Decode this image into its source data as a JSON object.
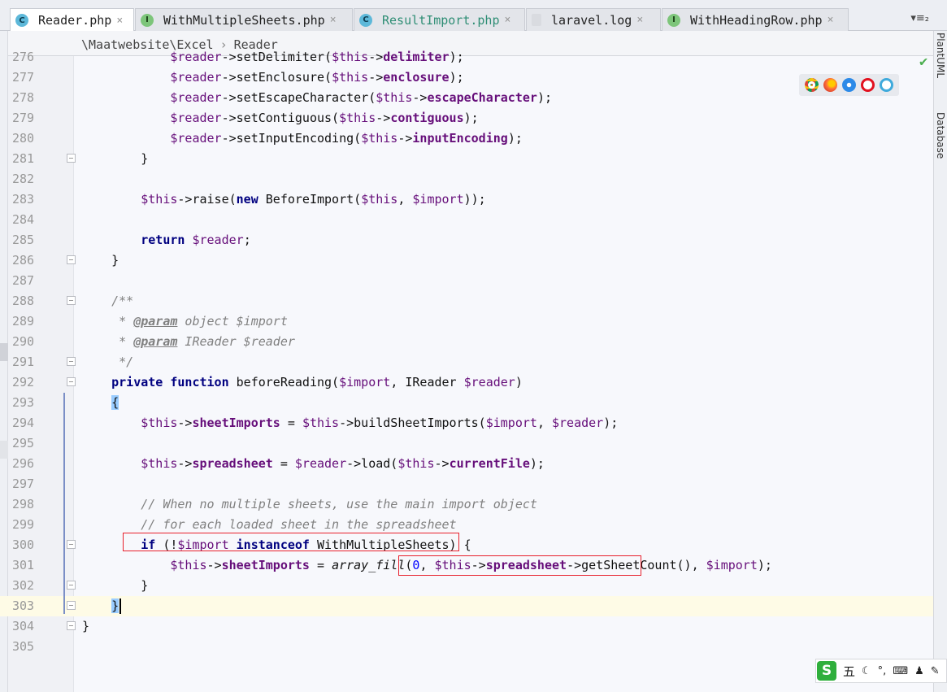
{
  "tabs": [
    {
      "label": "Reader.php",
      "icon": "C",
      "kind": "class",
      "active": true
    },
    {
      "label": "WithMultipleSheets.php",
      "icon": "I",
      "kind": "interface",
      "active": false
    },
    {
      "label": "ResultImport.php",
      "icon": "C",
      "kind": "class",
      "active": false
    },
    {
      "label": "laravel.log",
      "icon": "",
      "kind": "file",
      "active": false
    },
    {
      "label": "WithHeadingRow.php",
      "icon": "I",
      "kind": "interface",
      "active": false
    }
  ],
  "tab_close_glyph": "×",
  "tab_overflow_label": "▾≡₂",
  "breadcrumb": {
    "namespace": "\\Maatwebsite\\Excel",
    "separator": "›",
    "class": "Reader"
  },
  "right_tool_windows": [
    "PlantUML",
    "Database"
  ],
  "ime": {
    "logo": "S",
    "mode": "五",
    "items": [
      "☾",
      "°,",
      "⌨",
      "♟",
      "✎"
    ]
  },
  "lines": [
    {
      "n": "276",
      "tokens": [
        [
          "v",
          "            $reader"
        ],
        [
          "t",
          "->setDelimiter("
        ],
        [
          "v",
          "$this"
        ],
        [
          "t",
          "->"
        ],
        [
          "p",
          "delimiter"
        ],
        [
          "t",
          ");"
        ]
      ]
    },
    {
      "n": "277",
      "tokens": [
        [
          "v",
          "            $reader"
        ],
        [
          "t",
          "->setEnclosure("
        ],
        [
          "v",
          "$this"
        ],
        [
          "t",
          "->"
        ],
        [
          "p",
          "enclosure"
        ],
        [
          "t",
          ");"
        ]
      ]
    },
    {
      "n": "278",
      "tokens": [
        [
          "v",
          "            $reader"
        ],
        [
          "t",
          "->setEscapeCharacter("
        ],
        [
          "v",
          "$this"
        ],
        [
          "t",
          "->"
        ],
        [
          "p",
          "escapeCharacter"
        ],
        [
          "t",
          ");"
        ]
      ]
    },
    {
      "n": "279",
      "tokens": [
        [
          "v",
          "            $reader"
        ],
        [
          "t",
          "->setContiguous("
        ],
        [
          "v",
          "$this"
        ],
        [
          "t",
          "->"
        ],
        [
          "p",
          "contiguous"
        ],
        [
          "t",
          ");"
        ]
      ]
    },
    {
      "n": "280",
      "tokens": [
        [
          "v",
          "            $reader"
        ],
        [
          "t",
          "->setInputEncoding("
        ],
        [
          "v",
          "$this"
        ],
        [
          "t",
          "->"
        ],
        [
          "p",
          "inputEncoding"
        ],
        [
          "t",
          ");"
        ]
      ]
    },
    {
      "n": "281",
      "tokens": [
        [
          "t",
          "        }"
        ]
      ]
    },
    {
      "n": "282",
      "tokens": []
    },
    {
      "n": "283",
      "tokens": [
        [
          "v",
          "        $this"
        ],
        [
          "t",
          "->raise("
        ],
        [
          "k",
          "new"
        ],
        [
          "t",
          " BeforeImport("
        ],
        [
          "v",
          "$this"
        ],
        [
          "t",
          ", "
        ],
        [
          "v",
          "$import"
        ],
        [
          "t",
          "));"
        ]
      ]
    },
    {
      "n": "284",
      "tokens": []
    },
    {
      "n": "285",
      "tokens": [
        [
          "k",
          "        return"
        ],
        [
          "t",
          " "
        ],
        [
          "v",
          "$reader"
        ],
        [
          "t",
          ";"
        ]
      ]
    },
    {
      "n": "286",
      "tokens": [
        [
          "t",
          "    }"
        ]
      ]
    },
    {
      "n": "287",
      "tokens": []
    },
    {
      "n": "288",
      "tokens": [
        [
          "c",
          "    /**"
        ]
      ]
    },
    {
      "n": "289",
      "tokens": [
        [
          "c",
          "     * "
        ],
        [
          "g",
          "@param"
        ],
        [
          "c",
          " object $import"
        ]
      ]
    },
    {
      "n": "290",
      "tokens": [
        [
          "c",
          "     * "
        ],
        [
          "g",
          "@param"
        ],
        [
          "c",
          " IReader $reader"
        ]
      ]
    },
    {
      "n": "291",
      "tokens": [
        [
          "c",
          "     */"
        ]
      ]
    },
    {
      "n": "292",
      "tokens": [
        [
          "k",
          "    private function"
        ],
        [
          "t",
          " beforeReading("
        ],
        [
          "v",
          "$import"
        ],
        [
          "t",
          ", IReader "
        ],
        [
          "v",
          "$reader"
        ],
        [
          "t",
          ")"
        ]
      ]
    },
    {
      "n": "293",
      "tokens": [
        [
          "t",
          "    "
        ],
        [
          "b",
          "{"
        ]
      ]
    },
    {
      "n": "294",
      "tokens": [
        [
          "v",
          "        $this"
        ],
        [
          "t",
          "->"
        ],
        [
          "p",
          "sheetImports"
        ],
        [
          "t",
          " = "
        ],
        [
          "v",
          "$this"
        ],
        [
          "t",
          "->buildSheetImports("
        ],
        [
          "v",
          "$import"
        ],
        [
          "t",
          ", "
        ],
        [
          "v",
          "$reader"
        ],
        [
          "t",
          ");"
        ]
      ]
    },
    {
      "n": "295",
      "tokens": []
    },
    {
      "n": "296",
      "tokens": [
        [
          "v",
          "        $this"
        ],
        [
          "t",
          "->"
        ],
        [
          "p",
          "spreadsheet"
        ],
        [
          "t",
          " = "
        ],
        [
          "v",
          "$reader"
        ],
        [
          "t",
          "->load("
        ],
        [
          "v",
          "$this"
        ],
        [
          "t",
          "->"
        ],
        [
          "p",
          "currentFile"
        ],
        [
          "t",
          ");"
        ]
      ]
    },
    {
      "n": "297",
      "tokens": []
    },
    {
      "n": "298",
      "tokens": [
        [
          "c",
          "        // When no multiple sheets, use the main import object"
        ]
      ]
    },
    {
      "n": "299",
      "tokens": [
        [
          "c",
          "        // for each loaded sheet in the spreadsheet"
        ]
      ]
    },
    {
      "n": "300",
      "tokens": [
        [
          "k",
          "        if"
        ],
        [
          "t",
          " (!"
        ],
        [
          "v",
          "$import"
        ],
        [
          "t",
          " "
        ],
        [
          "k",
          "instanceof"
        ],
        [
          "t",
          " WithMultipleSheets) {"
        ]
      ]
    },
    {
      "n": "301",
      "tokens": [
        [
          "v",
          "            $this"
        ],
        [
          "t",
          "->"
        ],
        [
          "p",
          "sheetImports"
        ],
        [
          "t",
          " = "
        ],
        [
          "f",
          "array_fill"
        ],
        [
          "t",
          "("
        ],
        [
          "n",
          "0"
        ],
        [
          "t",
          ", "
        ],
        [
          "v",
          "$this"
        ],
        [
          "t",
          "->"
        ],
        [
          "p",
          "spreadsheet"
        ],
        [
          "t",
          "->getSheetCount(), "
        ],
        [
          "v",
          "$import"
        ],
        [
          "t",
          ");"
        ]
      ]
    },
    {
      "n": "302",
      "tokens": [
        [
          "t",
          "        }"
        ]
      ]
    },
    {
      "n": "303",
      "tokens": [
        [
          "t",
          "    "
        ],
        [
          "b",
          "}"
        ],
        [
          "x",
          ""
        ]
      ]
    },
    {
      "n": "304",
      "tokens": [
        [
          "t",
          "}"
        ]
      ]
    },
    {
      "n": "305",
      "tokens": []
    }
  ],
  "colors": {
    "variable": "#660e7a",
    "keyword": "#000080",
    "comment": "#808080",
    "number": "#0000ff",
    "highlight_box": "#e8202c",
    "current_line": "#fefbe6",
    "brace_match": "#99ccff"
  },
  "current_line": "303",
  "browser_icons": [
    "chrome-icon",
    "firefox-icon",
    "safari-icon",
    "opera-icon",
    "ie-icon"
  ]
}
